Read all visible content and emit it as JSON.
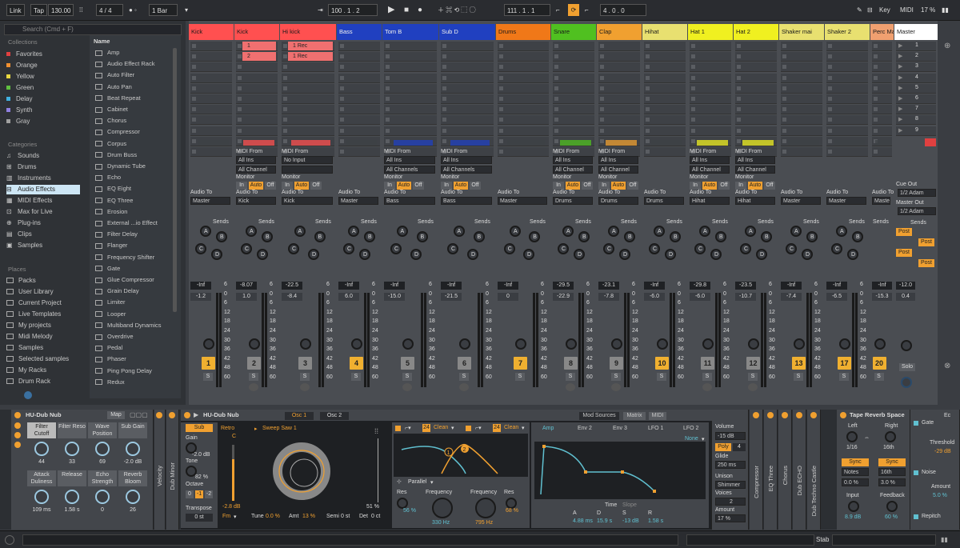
{
  "transport": {
    "link": "Link",
    "tap": "Tap",
    "tempo": "130.00",
    "sig": "4 / 4",
    "quant": "1 Bar",
    "position": "100 .  1 .  2",
    "loop_start": "111 .  1 .  1",
    "loop_len": "4 .  0 .  0",
    "key": "Key",
    "midi": "MIDI",
    "cpu": "17 %"
  },
  "browser": {
    "search_placeholder": "Search (Cmd + F)",
    "collections_title": "Collections",
    "collections": [
      {
        "label": "Favorites",
        "color": "#e04040"
      },
      {
        "label": "Orange",
        "color": "#f09030"
      },
      {
        "label": "Yellow",
        "color": "#e8d840"
      },
      {
        "label": "Green",
        "color": "#60c040"
      },
      {
        "label": "Delay",
        "color": "#40b0e0"
      },
      {
        "label": "Synth",
        "color": "#9080e0"
      },
      {
        "label": "Gray",
        "color": "#a0a0a0"
      }
    ],
    "categories_title": "Categories",
    "categories": [
      "Sounds",
      "Drums",
      "Instruments",
      "Audio Effects",
      "MIDI Effects",
      "Max for Live",
      "Plug-ins",
      "Clips",
      "Samples"
    ],
    "places_title": "Places",
    "places": [
      "Packs",
      "User Library",
      "Current Project",
      "Live Templates",
      "My projects",
      "Midi Melody",
      "Samples",
      "Selected samples",
      "My Racks",
      "Drum Rack"
    ],
    "name_header": "Name",
    "items": [
      "Amp",
      "Audio Effect Rack",
      "Auto Filter",
      "Auto Pan",
      "Beat Repeat",
      "Cabinet",
      "Chorus",
      "Compressor",
      "Corpus",
      "Drum Buss",
      "Dynamic Tube",
      "Echo",
      "EQ Eight",
      "EQ Three",
      "Erosion",
      "External ...io Effect",
      "Filter Delay",
      "Flanger",
      "Frequency Shifter",
      "Gate",
      "Glue Compressor",
      "Grain Delay",
      "Limiter",
      "Looper",
      "Multiband Dynamics",
      "Overdrive",
      "Pedal",
      "Phaser",
      "Ping Pong Delay",
      "Redux"
    ]
  },
  "tracks": [
    {
      "name": "Kick",
      "color": "#ff5050",
      "vol": "-Inf",
      "pan": "-1.2",
      "num": "1",
      "num_on": true,
      "out": "Master",
      "io": false,
      "clips": []
    },
    {
      "name": "Kick",
      "color": "#ff5050",
      "vol": "-8.07",
      "pan": "1.0",
      "num": "2",
      "num_on": false,
      "out": "Kick",
      "io": true,
      "from": "All Ins",
      "ch": "All Channel",
      "clips": [
        "1",
        "2"
      ]
    },
    {
      "name": "Hi kick",
      "color": "#ff5050",
      "vol": "-22.5",
      "pan": "-8.4",
      "num": "3",
      "num_on": false,
      "out": "Kick",
      "io": true,
      "from": "No Input",
      "ch": "",
      "clips": [
        "1 Rec",
        "1 Rec"
      ]
    },
    {
      "name": "Bass",
      "color": "#2040c0",
      "vol": "-Inf",
      "pan": "6.0",
      "num": "4",
      "num_on": true,
      "out": "Master",
      "io": false,
      "clips": []
    },
    {
      "name": "Tom B",
      "color": "#2040c0",
      "vol": "-Inf",
      "pan": "-15.0",
      "num": "5",
      "num_on": false,
      "out": "Bass",
      "io": true,
      "from": "All Ins",
      "ch": "All Channels",
      "clips": []
    },
    {
      "name": "Sub D",
      "color": "#2040c0",
      "vol": "-Inf",
      "pan": "-21.5",
      "num": "6",
      "num_on": false,
      "out": "Bass",
      "io": true,
      "from": "All Ins",
      "ch": "All Channels",
      "clips": []
    },
    {
      "name": "Drums",
      "color": "#f07818",
      "vol": "-Inf",
      "pan": "0",
      "num": "7",
      "num_on": true,
      "out": "Master",
      "io": false,
      "clips": []
    },
    {
      "name": "Snare",
      "color": "#50c020",
      "vol": "-29.5",
      "pan": "-22.9",
      "num": "8",
      "num_on": false,
      "out": "Drums",
      "io": true,
      "from": "All Ins",
      "ch": "All Channel",
      "clips": []
    },
    {
      "name": "Clap",
      "color": "#f0a030",
      "vol": "-23.1",
      "pan": "-7.8",
      "num": "9",
      "num_on": false,
      "out": "Drums",
      "io": true,
      "from": "All Ins",
      "ch": "All Channel",
      "clips": []
    },
    {
      "name": "Hihat",
      "color": "#e8e070",
      "vol": "-Inf",
      "pan": "-6.0",
      "num": "10",
      "num_on": true,
      "out": "Drums",
      "io": false,
      "clips": []
    },
    {
      "name": "Hat 1",
      "color": "#f0f020",
      "vol": "-29.8",
      "pan": "-6.0",
      "num": "11",
      "num_on": false,
      "out": "Hihat",
      "io": true,
      "from": "All Ins",
      "ch": "All Channel",
      "clips": []
    },
    {
      "name": "Hat 2",
      "color": "#f0f020",
      "vol": "-23.5",
      "pan": "-10.7",
      "num": "12",
      "num_on": false,
      "out": "Hihat",
      "io": true,
      "from": "All Ins",
      "ch": "All Channel",
      "clips": []
    },
    {
      "name": "Shaker mai",
      "color": "#e8e070",
      "vol": "-Inf",
      "pan": "-7.4",
      "num": "13",
      "num_on": true,
      "out": "Master",
      "io": false,
      "clips": []
    },
    {
      "name": "Shaker 2",
      "color": "#e8e070",
      "vol": "-Inf",
      "pan": "-6.5",
      "num": "17",
      "num_on": true,
      "out": "Master",
      "io": false,
      "clips": []
    },
    {
      "name": "Perc Ma",
      "color": "#f0a070",
      "vol": "-Inf",
      "pan": "-15.3",
      "num": "20",
      "num_on": true,
      "out": "Master",
      "io": false,
      "clips": []
    }
  ],
  "master": {
    "name": "Master",
    "vol": "-12.0",
    "pan": "0.4",
    "cue_label": "Cue Out",
    "cue": "1/2 Adam",
    "master_label": "Master Out",
    "out": "1/2 Adam",
    "solo": "Solo",
    "scenes": [
      "1",
      "2",
      "3",
      "4",
      "5",
      "6",
      "7",
      "8",
      "9"
    ],
    "sends": [
      "Post",
      "Post",
      "Post",
      "Post"
    ]
  },
  "labels": {
    "midi_from": "MIDI From",
    "monitor": "Monitor",
    "in": "In",
    "auto": "Auto",
    "off": "Off",
    "audio_to": "Audio To",
    "sends": "Sends",
    "send_letters": [
      "A",
      "B",
      "C",
      "D",
      "E"
    ],
    "db_scale": [
      "6",
      "0",
      "6",
      "12",
      "18",
      "24",
      "30",
      "36",
      "42",
      "48",
      "60"
    ],
    "s": "S"
  },
  "rack": {
    "title": "HU-Dub Nub",
    "map": "Map",
    "macros": [
      {
        "name": "Filter Cutoff",
        "val": "44"
      },
      {
        "name": "Filter Reso",
        "val": "33"
      },
      {
        "name": "Wave Position",
        "val": "69"
      },
      {
        "name": "Sub Gain",
        "val": "-2.0 dB"
      },
      {
        "name": "Attack Duliness",
        "val": "109 ms"
      },
      {
        "name": "Release",
        "val": "1.58 s"
      },
      {
        "name": "Echo Strength",
        "val": "0"
      },
      {
        "name": "Reverb Bloom",
        "val": "26"
      }
    ]
  },
  "vertical_labels": [
    "Velocity",
    "Dub Minor"
  ],
  "wavetable": {
    "title": "HU-Dub Nub",
    "osc1": "Osc 1",
    "osc2": "Osc 2",
    "sub": "Sub",
    "gain_label": "Gain",
    "gain": "-2.0 dB",
    "tone_label": "Tone",
    "tone": "82 %",
    "octave_label": "Octave",
    "octave_vals": [
      "0",
      "-1",
      "-2"
    ],
    "transpose_label": "Transpose",
    "transpose": "0 st",
    "category": "Retro",
    "wave": "Sweep Saw 1",
    "osc_db": "-2.8 dB",
    "osc_pct": "51 %",
    "fm": "Fm",
    "tune_label": "Tune",
    "tune": "0.0 %",
    "amt_label": "Amt",
    "amt": "13 %",
    "semi_label": "Semi",
    "semi": "0 st",
    "det_label": "Det",
    "det": "0 ct",
    "filter_slope1": "24",
    "filter_slope2": "24",
    "filter_type1": "Clean",
    "filter_type2": "Clean",
    "parallel": "Parallel",
    "res1_label": "Res",
    "res1": "56 %",
    "freq1_label": "Frequency",
    "freq1": "330 Hz",
    "freq2_label": "Frequency",
    "freq2": "795 Hz",
    "res2_label": "Res",
    "res2": "68 %",
    "mod_tab1": "Mod Sources",
    "mod_tab2": "Matrix",
    "mod_tab3": "MIDI",
    "env_tabs": [
      "Amp",
      "Env 2",
      "Env 3",
      "LFO 1",
      "LFO 2"
    ],
    "none": "None",
    "time": "Time",
    "slope": "Slope",
    "adsr_labels": [
      "A",
      "D",
      "S",
      "R"
    ],
    "adsr": [
      "4.88 ms",
      "15.9 s",
      "-13 dB",
      "1.58 s"
    ],
    "volume_label": "Volume",
    "volume": "-15 dB",
    "poly": "Poly",
    "poly_n": "4",
    "glide_label": "Glide",
    "glide": "250 ms",
    "unison_label": "Unison",
    "unison": "Shimmer",
    "voices_label": "Voices",
    "voices": "2",
    "amount_label": "Amount",
    "amount": "17 %"
  },
  "chain": [
    "Compressor",
    "EQ Three",
    "Chorus",
    "Dub ECHO",
    "Dub Techno Castle"
  ],
  "tape": {
    "title": "Tape Reverb Space",
    "left_label": "Left",
    "left": "1/16",
    "right_label": "Right",
    "right": "16th",
    "sync": "Sync",
    "notes": "Notes",
    "pct": "0.0 %",
    "pct2": "3.0 %",
    "input_label": "Input",
    "input": "8.9 dB",
    "feedback_label": "Feedback",
    "feedback": "60 %"
  },
  "gate": {
    "title": "Gate",
    "threshold_label": "Threshold",
    "threshold": "-29 dB",
    "noise": "Noise",
    "amount_label": "Amount",
    "amount": "5.0 %",
    "repitch": "Repitch",
    "ec": "Ec"
  },
  "status": {
    "stab": "Stab"
  }
}
